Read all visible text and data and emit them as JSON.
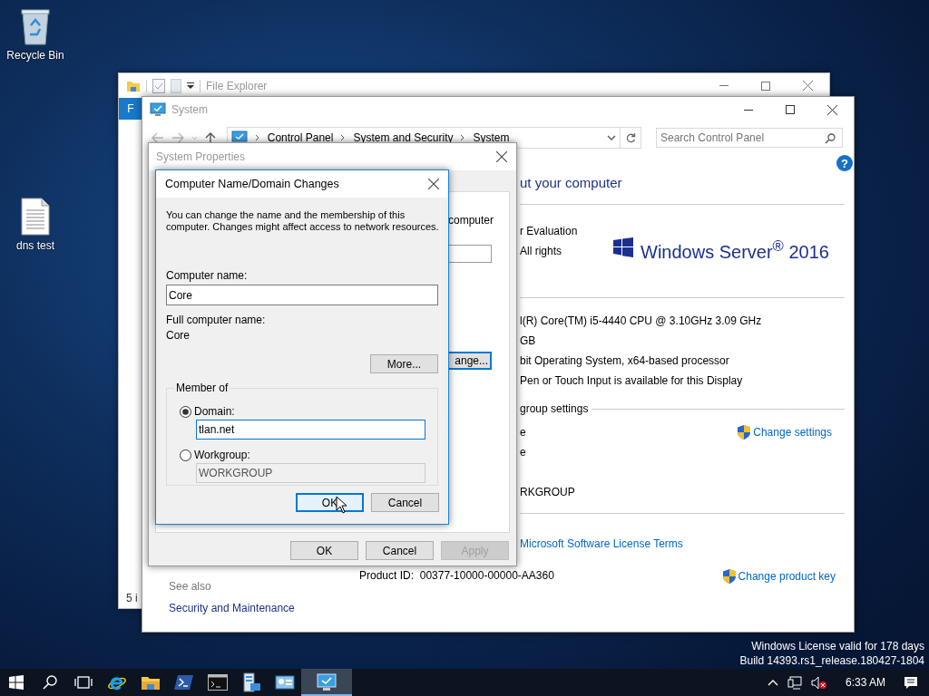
{
  "desktop": {
    "icons": [
      {
        "label": "Recycle Bin",
        "kind": "recycle"
      },
      {
        "label": "dns test",
        "kind": "document"
      }
    ],
    "evaluation_notice": [
      "Windows License valid for 178 days",
      "Build 14393.rs1_release.180427-1804"
    ]
  },
  "file_explorer": {
    "title": "File Explorer",
    "ribbon_tab": "F",
    "status": "5 i"
  },
  "system_window": {
    "title": "System",
    "breadcrumbs": [
      "Control Panel",
      "System and Security",
      "System"
    ],
    "search": {
      "placeholder": "Search Control Panel"
    },
    "heading": "ut your computer",
    "edition_lines": [
      "r Evaluation",
      "All rights"
    ],
    "logo_text": "Windows Server$^{®}$ 2016",
    "system_rows": [
      "l(R) Core(TM) i5-4440 CPU @ 3.10GHz   3.09 GHz",
      "GB",
      "bit Operating System, x64-based processor",
      "Pen or Touch Input is available for this Display"
    ],
    "help_icon": "?",
    "name_section_title": "group settings",
    "name_rows": [
      "e",
      "e",
      "RKGROUP"
    ],
    "change_settings": "Change settings",
    "license_link": "Microsoft Software License Terms",
    "product_id_label": "Product ID:",
    "product_id": "00377-10000-00000-AA360",
    "change_product_key": "Change product key",
    "see_also": "See also",
    "see_also_links": [
      "Security and Maintenance"
    ]
  },
  "system_properties": {
    "title": "System Properties",
    "panel_text": "computer",
    "change_button": "ange...",
    "buttons": [
      {
        "label": "OK",
        "disabled": false
      },
      {
        "label": "Cancel",
        "disabled": false
      },
      {
        "label": "Apply",
        "disabled": true
      }
    ]
  },
  "name_dialog": {
    "title": "Computer Name/Domain Changes",
    "description": "You can change the name and the membership of this computer. Changes might affect access to network resources.",
    "computer_name": {
      "label": "Computer name:",
      "value": "Core"
    },
    "full_name": {
      "label": "Full computer name:",
      "value": "Core"
    },
    "more_button": "More...",
    "member_of": {
      "title": "Member of",
      "options": [
        {
          "label": "Domain:",
          "selected": true,
          "value": "tlan.net"
        },
        {
          "label": "Workgroup:",
          "selected": false,
          "value": "WORKGROUP"
        }
      ]
    },
    "buttons": [
      {
        "label": "OK",
        "default": true
      },
      {
        "label": "Cancel",
        "default": false
      }
    ]
  },
  "taskbar": {
    "apps": [
      {
        "kind": "browser",
        "active": false
      },
      {
        "kind": "folder",
        "active": false
      },
      {
        "kind": "shell",
        "active": false
      },
      {
        "kind": "console",
        "active": false
      },
      {
        "kind": "server",
        "active": false
      },
      {
        "kind": "card",
        "active": false
      },
      {
        "kind": "monitor",
        "active": true
      }
    ],
    "clock": "6:33 AM"
  }
}
